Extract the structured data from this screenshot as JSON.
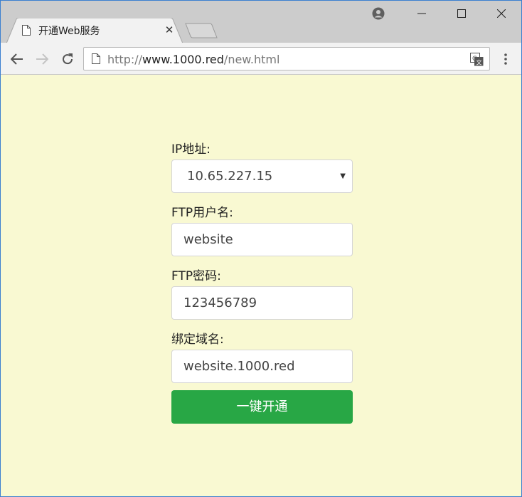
{
  "browser": {
    "tab_title": "开通Web服务",
    "tab_close_glyph": "✕",
    "url_scheme": "http://",
    "url_host": "www.1000.red",
    "url_path": "/new.html"
  },
  "form": {
    "ip_label": "IP地址:",
    "ip_value": "10.65.227.15",
    "ftp_user_label": "FTP用户名:",
    "ftp_user_value": "website",
    "ftp_pass_label": "FTP密码:",
    "ftp_pass_value": "123456789",
    "domain_label": "绑定域名:",
    "domain_value": "website.1000.red",
    "submit_label": "一键开通"
  },
  "colors": {
    "page_background": "#f9f9d2",
    "submit_button": "#28a745",
    "window_border": "#3a7fd0"
  },
  "icons": [
    "page-icon",
    "close-icon",
    "new-tab-icon",
    "profile-icon",
    "minimize-icon",
    "maximize-icon",
    "window-close-icon",
    "back-arrow-icon",
    "forward-arrow-icon",
    "reload-icon",
    "translate-icon",
    "kebab-menu-icon",
    "chevron-down-icon"
  ]
}
